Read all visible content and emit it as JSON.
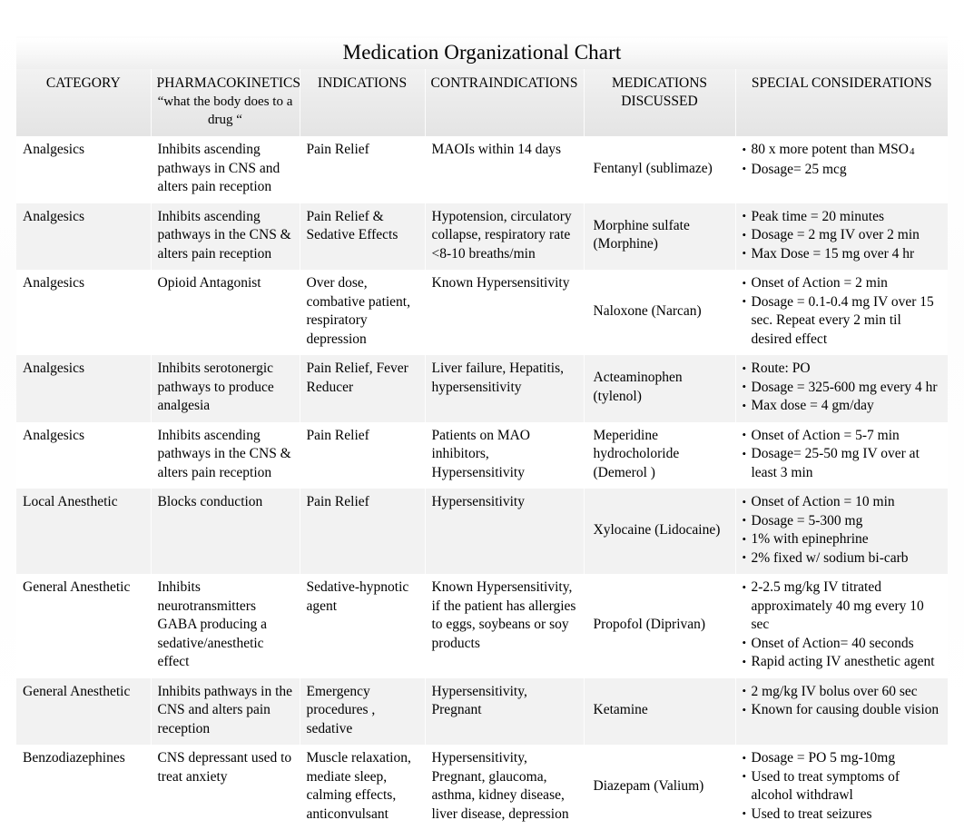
{
  "document": {
    "title": "Medication Organizational Chart"
  },
  "table": {
    "headers": [
      {
        "main": "CATEGORY",
        "sub": ""
      },
      {
        "main": "PHARMACOKINETICS",
        "sub": "“what the body does to a drug “"
      },
      {
        "main": "INDICATIONS",
        "sub": ""
      },
      {
        "main": "CONTRAINDICATIONS",
        "sub": ""
      },
      {
        "main": "MEDICATIONS DISCUSSED",
        "sub": ""
      },
      {
        "main": "SPECIAL CONSIDERATIONS",
        "sub": ""
      }
    ],
    "rows": [
      {
        "category": "Analgesics",
        "pharmacokinetics": "Inhibits ascending pathways in CNS and alters pain reception",
        "indications": "Pain Relief",
        "contraindications": "MAOIs within 14 days",
        "medication": "Fentanyl (sublimaze)",
        "considerations": [
          "80 x more potent than MSO",
          "Dosage= 25 mcg"
        ],
        "considerations_subscript": "4"
      },
      {
        "category": "Analgesics",
        "pharmacokinetics": "Inhibits ascending pathways in the CNS & alters pain reception",
        "indications": "Pain Relief & Sedative Effects",
        "contraindications": "Hypotension, circulatory collapse, respiratory rate <8-10 breaths/min",
        "medication": "Morphine sulfate (Morphine)",
        "considerations": [
          "Peak time = 20 minutes",
          "Dosage = 2 mg IV over 2 min",
          "Max Dose = 15 mg over 4 hr"
        ]
      },
      {
        "category": "Analgesics",
        "pharmacokinetics": "Opioid Antagonist",
        "indications": "Over dose, combative patient, respiratory depression",
        "contraindications": "Known Hypersensitivity",
        "medication": "Naloxone (Narcan)",
        "considerations": [
          "Onset of Action = 2 min",
          " Dosage = 0.1-0.4 mg IV over 15 sec. Repeat every 2 min til desired effect"
        ]
      },
      {
        "category": "Analgesics",
        "pharmacokinetics": "Inhibits  serotonergic pathways to produce analgesia",
        "indications": "Pain Relief, Fever Reducer",
        "contraindications": "Liver failure, Hepatitis, hypersensitivity",
        "medication": "Acteaminophen (tylenol)",
        "considerations": [
          "Route: PO",
          "Dosage = 325-600 mg every 4 hr",
          "Max dose = 4 gm/day"
        ]
      },
      {
        "category": "Analgesics",
        "pharmacokinetics": "Inhibits ascending pathways in the CNS & alters pain reception",
        "indications": "Pain Relief",
        "contraindications": "Patients on MAO inhibitors, Hypersensitivity",
        "medication": "Meperidine hydrocholoride (Demerol )",
        "considerations": [
          "Onset of Action = 5-7 min",
          "Dosage= 25-50 mg IV over at least 3 min"
        ]
      },
      {
        "category": "Local Anesthetic",
        "pharmacokinetics": "Blocks conduction",
        "indications": "Pain Relief",
        "contraindications": "Hypersensitivity",
        "medication": "Xylocaine (Lidocaine)",
        "considerations": [
          "Onset of Action = 10 min",
          "Dosage = 5-300 mg",
          "1% with epinephrine",
          "2% fixed w/ sodium bi-carb"
        ]
      },
      {
        "category": "General Anesthetic",
        "pharmacokinetics": "Inhibits neurotransmitters GABA producing a sedative/anesthetic effect",
        "indications": "Sedative-hypnotic agent",
        "contraindications": "Known Hypersensitivity, if the patient has allergies to eggs, soybeans or soy products",
        "medication": "Propofol (Diprivan)",
        "considerations": [
          " 2-2.5 mg/kg IV titrated approximately 40 mg every 10 sec",
          "Onset of Action= 40 seconds",
          "Rapid acting IV anesthetic agent"
        ]
      },
      {
        "category": "General Anesthetic",
        "pharmacokinetics": "Inhibits pathways in the CNS and alters pain reception",
        "indications": "Emergency procedures , sedative",
        "contraindications": "Hypersensitivity, Pregnant",
        "medication": "Ketamine",
        "considerations": [
          "2 mg/kg IV bolus over 60 sec",
          "Known for causing double vision"
        ]
      },
      {
        "category": "Benzodiazephines",
        "pharmacokinetics": "CNS depressant used to treat anxiety",
        "indications": "Muscle relaxation, mediate sleep, calming effects, anticonvulsant",
        "contraindications": "Hypersensitivity, Pregnant, glaucoma, asthma, kidney disease, liver disease, depression",
        "medication": "Diazepam (Valium)",
        "considerations": [
          "Dosage = PO 5 mg-10mg",
          "Used to treat symptoms of alcohol withdrawl",
          "Used to treat seizures"
        ]
      }
    ]
  }
}
